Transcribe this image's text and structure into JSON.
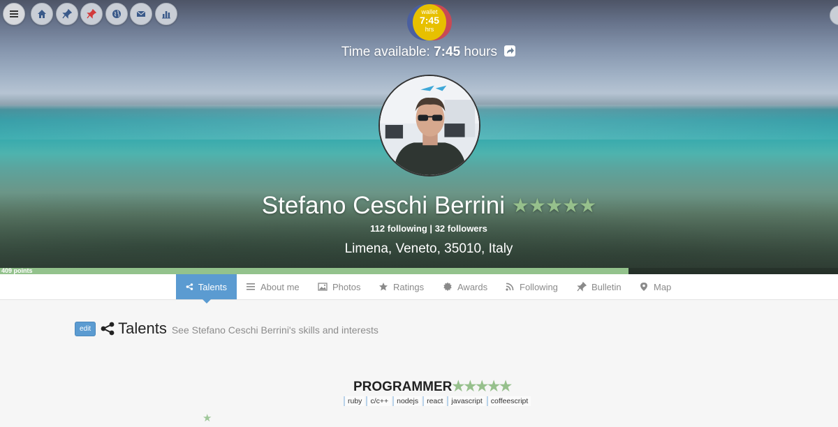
{
  "nav": {
    "buttons": [
      "menu-icon",
      "home-icon",
      "pin-icon",
      "pin-red-icon",
      "globe-icon",
      "mail-icon",
      "stats-icon"
    ]
  },
  "wallet": {
    "top": "wallet",
    "value": "7:45",
    "bottom": "hrs"
  },
  "time": {
    "label": "Time available:",
    "value": "7:45",
    "unit": "hours"
  },
  "profile": {
    "name": "Stefano Ceschi Berrini",
    "stars": "★★★★★",
    "following": "112 following",
    "separator": "|",
    "followers": "32 followers",
    "location": "Limena, Veneto, 35010, Italy"
  },
  "progress": {
    "label": "409 points",
    "fraction": 0.75
  },
  "tabs": [
    {
      "label": "Talents",
      "icon": "share-icon",
      "active": true
    },
    {
      "label": "About me",
      "icon": "list-icon"
    },
    {
      "label": "Photos",
      "icon": "image-icon"
    },
    {
      "label": "Ratings",
      "icon": "star-icon"
    },
    {
      "label": "Awards",
      "icon": "award-icon"
    },
    {
      "label": "Following",
      "icon": "rss-icon"
    },
    {
      "label": "Bulletin",
      "icon": "pin-icon"
    },
    {
      "label": "Map",
      "icon": "map-marker-icon"
    }
  ],
  "section": {
    "edit": "edit",
    "title": "Talents",
    "subtitle": "See Stefano Ceschi Berrini's skills and interests"
  },
  "talent": {
    "name": "PROGRAMMER",
    "stars": "★★★★★",
    "tags": [
      "ruby",
      "c/c++",
      "nodejs",
      "react",
      "javascript",
      "coffeescript"
    ]
  },
  "decor": {
    "lone_star": "★"
  },
  "colors": {
    "accent": "#5b9bd1",
    "star": "#96c08c",
    "progress": "#93c28c"
  }
}
